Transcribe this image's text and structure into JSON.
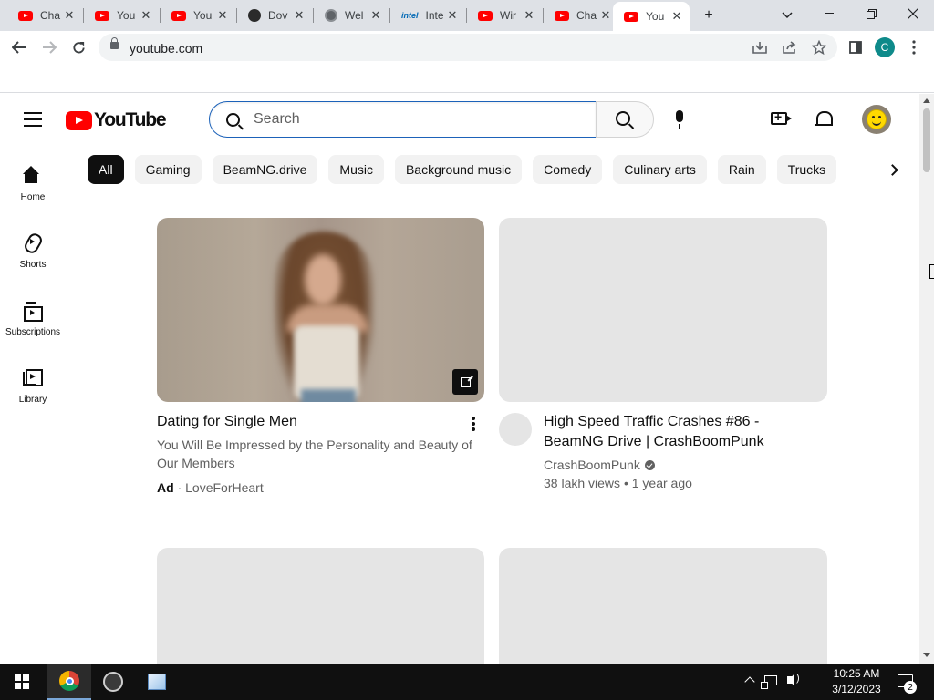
{
  "browser": {
    "tabs": [
      {
        "title": "Cha",
        "favicon": "youtube-favicon"
      },
      {
        "title": "You",
        "favicon": "youtube-favicon"
      },
      {
        "title": "You",
        "favicon": "youtube-favicon"
      },
      {
        "title": "Dov",
        "favicon": "obs-favicon"
      },
      {
        "title": "Wel",
        "favicon": "globe-favicon"
      },
      {
        "title": "Inte",
        "favicon": "intel-favicon"
      },
      {
        "title": "Wir",
        "favicon": "youtube-favicon"
      },
      {
        "title": "Cha",
        "favicon": "youtube-favicon"
      },
      {
        "title": "You",
        "favicon": "youtube-favicon"
      }
    ],
    "intel_favicon_text": "intel",
    "new_tab_symbol": "+",
    "tab_close_symbol": "✕",
    "url": "youtube.com",
    "profile_initial": "C"
  },
  "youtube": {
    "logo_text": "YouTube",
    "search": {
      "placeholder": "Search",
      "value": ""
    },
    "chips": [
      "All",
      "Gaming",
      "BeamNG.drive",
      "Music",
      "Background music",
      "Comedy",
      "Culinary arts",
      "Rain",
      "Trucks"
    ],
    "selected_chip": "All",
    "guide": [
      {
        "label": "Home",
        "icon": "home-icon"
      },
      {
        "label": "Shorts",
        "icon": "shorts-icon"
      },
      {
        "label": "Subscriptions",
        "icon": "subscriptions-icon"
      },
      {
        "label": "Library",
        "icon": "library-icon"
      }
    ],
    "videos": [
      {
        "title": "Dating for Single Men",
        "description": "You Will Be Impressed by the Personality and Beauty of Our Members",
        "ad_label": "Ad",
        "separator": "·",
        "advertiser": "LoveForHeart"
      },
      {
        "title": "High Speed Traffic Crashes #86 - BeamNG Drive | CrashBoomPunk",
        "channel": "CrashBoomPunk",
        "views": "38 lakh views",
        "separator": "•",
        "age": "1 year ago"
      }
    ]
  },
  "taskbar": {
    "time": "10:25 AM",
    "date": "3/12/2023",
    "notification_count": "2",
    "apps": [
      "chrome-icon",
      "obs-icon",
      "paint-icon"
    ]
  },
  "colors": {
    "youtube_red": "#ff0000",
    "chip_selected_bg": "#0f0f0f",
    "chip_bg": "#f2f2f2",
    "search_focus_border": "#1c62b9",
    "secondary_text": "#606060",
    "taskbar_bg": "#101010"
  }
}
